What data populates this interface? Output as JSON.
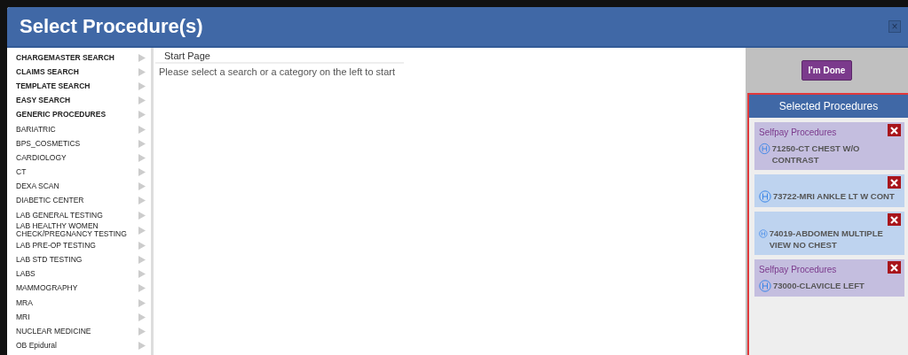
{
  "window": {
    "title": "Select Procedure(s)",
    "close": "×"
  },
  "sidebar": {
    "items": [
      {
        "label": "CHARGEMASTER SEARCH",
        "kind": "search"
      },
      {
        "label": "CLAIMS SEARCH",
        "kind": "search"
      },
      {
        "label": "TEMPLATE SEARCH",
        "kind": "search"
      },
      {
        "label": "EASY SEARCH",
        "kind": "search"
      },
      {
        "label": "GENERIC PROCEDURES",
        "kind": "search"
      },
      {
        "label": "BARIATRIC",
        "kind": "category"
      },
      {
        "label": "BPS_COSMETICS",
        "kind": "category"
      },
      {
        "label": "CARDIOLOGY",
        "kind": "category"
      },
      {
        "label": "CT",
        "kind": "category"
      },
      {
        "label": "DEXA SCAN",
        "kind": "category"
      },
      {
        "label": "DIABETIC CENTER",
        "kind": "category"
      },
      {
        "label": "LAB GENERAL TESTING",
        "kind": "category"
      },
      {
        "label": "LAB HEALTHY WOMEN CHECK/PREGNANCY TESTING",
        "kind": "category"
      },
      {
        "label": "LAB PRE-OP TESTING",
        "kind": "category"
      },
      {
        "label": "LAB STD TESTING",
        "kind": "category"
      },
      {
        "label": "LABS",
        "kind": "category"
      },
      {
        "label": "MAMMOGRAPHY",
        "kind": "category"
      },
      {
        "label": "MRA",
        "kind": "category"
      },
      {
        "label": "MRI",
        "kind": "category"
      },
      {
        "label": "NUCLEAR MEDICINE",
        "kind": "category"
      },
      {
        "label": "OB Epidural",
        "kind": "category"
      }
    ]
  },
  "content": {
    "heading": "Start Page",
    "message": "Please select a search or a category on the left to start"
  },
  "done_button": "I'm Done",
  "selected_panel": {
    "title": "Selected Procedures",
    "procedures": [
      {
        "kind": "selfpay",
        "group": "Selfpay Procedures",
        "name": "71250-CT CHEST W/O CONTRAST"
      },
      {
        "kind": "standard",
        "name": "73722-MRI ANKLE LT W CONT"
      },
      {
        "kind": "standard",
        "name": "74019-ABDOMEN MULTIPLE VIEW NO CHEST"
      },
      {
        "kind": "selfpay",
        "group": "Selfpay Procedures",
        "name": "73000-CLAVICLE LEFT"
      }
    ]
  }
}
